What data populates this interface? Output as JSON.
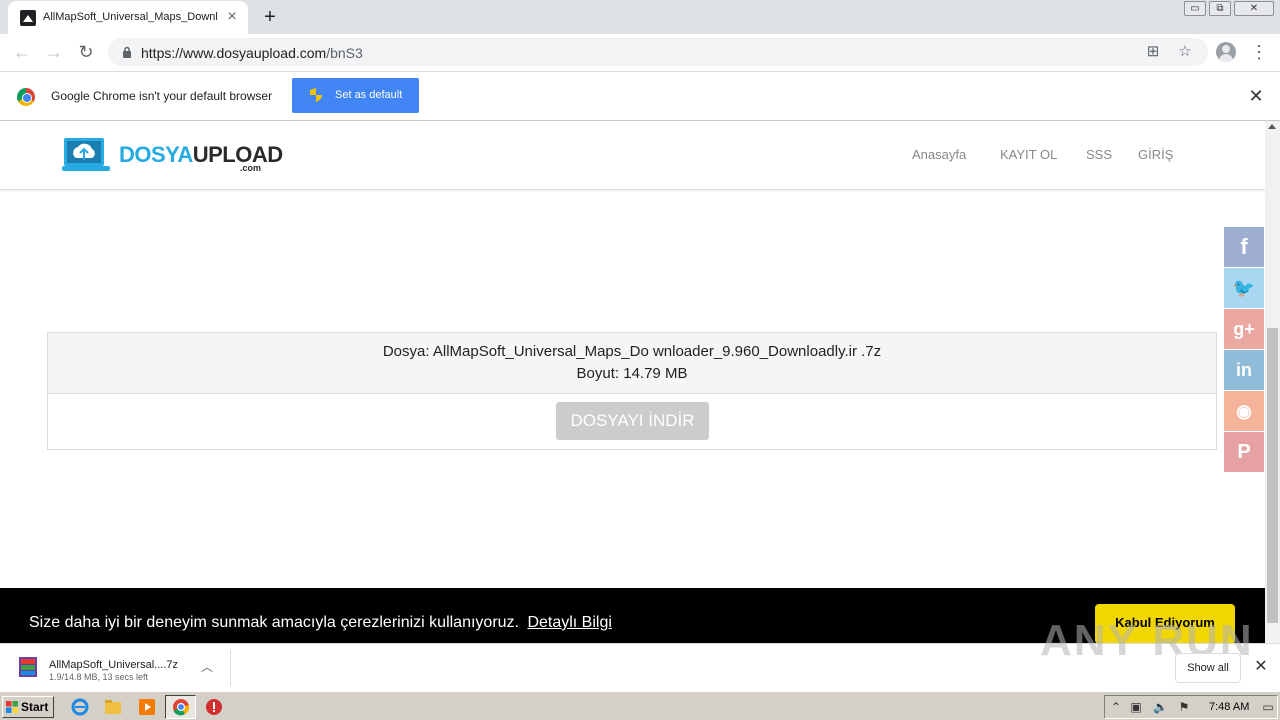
{
  "browser": {
    "tab_title": "AllMapSoft_Universal_Maps_Downlo",
    "url_host": "https://www.dosyaupload.com",
    "url_path": "/bnS3",
    "window_controls": [
      "▭",
      "⧉",
      "✕"
    ]
  },
  "infobar": {
    "message": "Google Chrome isn't your default browser",
    "button_label": "Set as default"
  },
  "site": {
    "logo_main": "DOSYA",
    "logo_accent": "UPLOAD",
    "logo_sub": ".com",
    "nav": [
      "Anasayfa",
      "KAYIT OL",
      "SSS",
      "GİRİŞ"
    ]
  },
  "file": {
    "name_line": "Dosya: AllMapSoft_Universal_Maps_Do wnloader_9.960_Downloadly.ir .7z",
    "size_line": "Boyut: 14.79 MB",
    "download_label": "DOSYAYI İNDİR"
  },
  "social": [
    {
      "name": "facebook",
      "glyph": "f",
      "color": "#9eaed0"
    },
    {
      "name": "twitter",
      "glyph": "🐦",
      "color": "#a9d6f1"
    },
    {
      "name": "google-plus",
      "glyph": "g+",
      "color": "#eba8a0"
    },
    {
      "name": "linkedin",
      "glyph": "in",
      "color": "#8fbcd8"
    },
    {
      "name": "reddit",
      "glyph": "◉",
      "color": "#f5b49a"
    },
    {
      "name": "pinterest",
      "glyph": "P",
      "color": "#e6a1a5"
    }
  ],
  "cookie": {
    "text": "Size daha iyi bir deneyim sunmak amacıyla çerezlerinizi kullanıyoruz.",
    "link": "Detaylı Bilgi",
    "accept": "Kabul Ediyorum"
  },
  "download_shelf": {
    "file_name": "AllMapSoft_Universal....7z",
    "status": "1.9/14.8 MB, 13 secs left",
    "show_all": "Show all"
  },
  "watermark": "ANY RUN",
  "taskbar": {
    "start_label": "Start",
    "clock": "7:48 AM"
  },
  "colors": {
    "brand_blue": "#27a9e1",
    "chrome_blue": "#4285f4",
    "cookie_accept": "#f1d600"
  }
}
